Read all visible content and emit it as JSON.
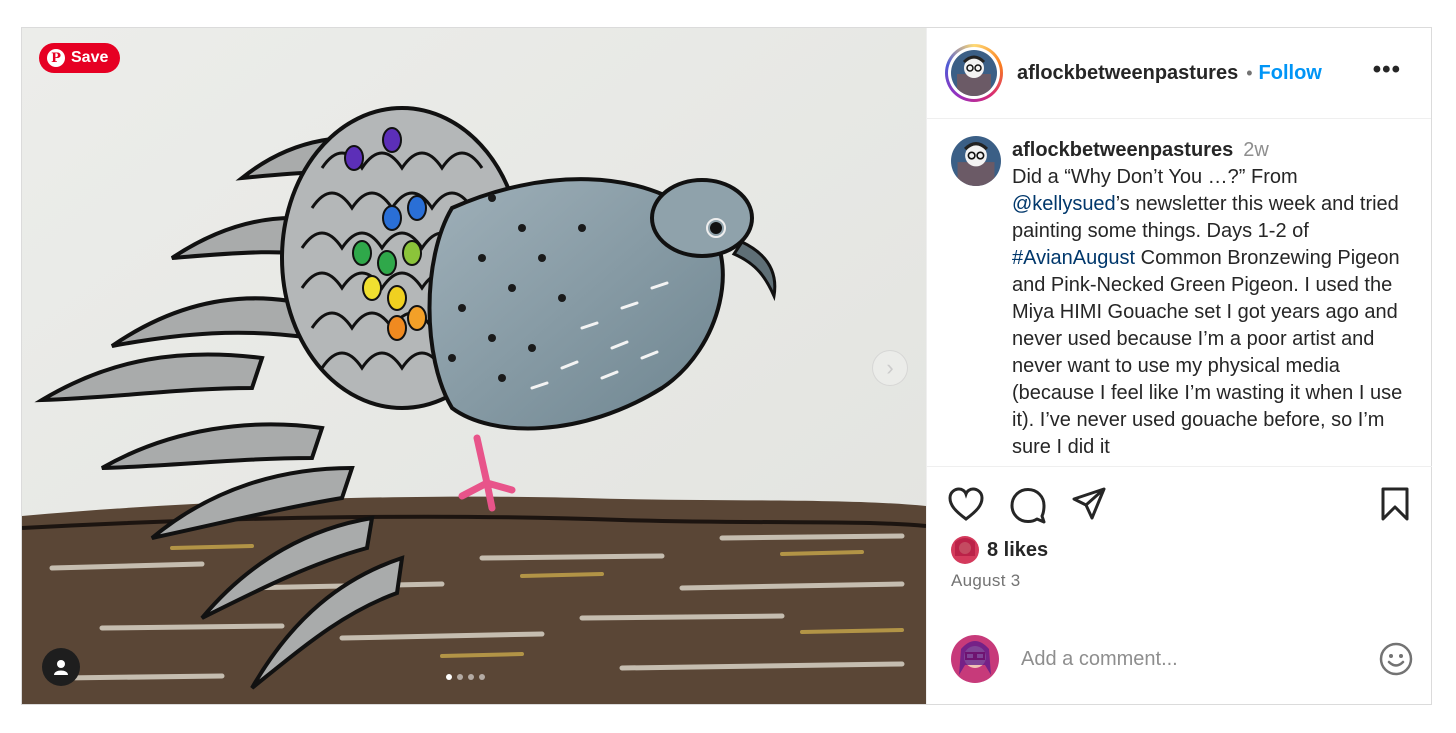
{
  "media": {
    "save_label": "Save",
    "pinterest_icon": "pinterest-icon",
    "next_icon": "chevron-right-icon",
    "user_tag_icon": "person-icon",
    "carousel_dots": 4,
    "carousel_active": 1
  },
  "header": {
    "username": "aflockbetweenpastures",
    "separator": "•",
    "follow_label": "Follow",
    "more_label": "•••"
  },
  "caption": {
    "username": "aflockbetweenpastures",
    "time": "2w",
    "text_1": "Did a “Why Don’t You …?” From ",
    "mention": "@kellysued",
    "text_2": "’s newsletter this week and tried painting some things. Days 1-2 of ",
    "hashtag": "#AvianAugust",
    "text_3": " Common Bronzewing Pigeon and Pink-Necked Green Pigeon. I used the Miya HIMI Gouache set I got years ago and never used because I’m a poor artist and never want to use my physical media (because I feel like I’m wasting it when I use it). I’ve never used gouache before, so I’m sure I did it"
  },
  "actions": {
    "like_icon": "heart-icon",
    "comment_icon": "comment-icon",
    "share_icon": "share-icon",
    "save_icon": "bookmark-icon"
  },
  "likes": "8 likes",
  "date": "August 3",
  "comment": {
    "placeholder": "Add a comment...",
    "emoji_icon": "emoji-icon"
  },
  "colors": {
    "follow_blue": "#0095f6",
    "link_blue": "#00376b",
    "pinterest_red": "#e60023",
    "border": "#dbdbdb"
  }
}
